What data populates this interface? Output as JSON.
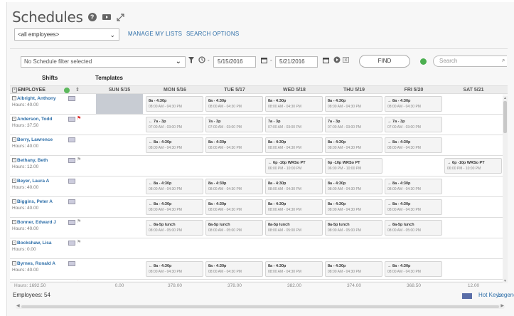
{
  "header": {
    "title": "Schedules",
    "help_icon": "?",
    "employee_select": "<all employees>",
    "links": [
      "MANAGE MY LISTS",
      "SEARCH OPTIONS"
    ]
  },
  "filter": {
    "placeholder": "No Schedule filter selected",
    "start_date": "5/15/2016",
    "end_date": "5/21/2016",
    "find_label": "FIND",
    "search_placeholder": "Search"
  },
  "tabs": [
    "Shifts",
    "Templates"
  ],
  "columns": {
    "employee": "EMPLOYEE",
    "days": [
      "SUN 5/15",
      "MON 5/16",
      "TUE 5/17",
      "WED 5/18",
      "THU 5/19",
      "FRI 5/20",
      "SAT 5/21"
    ]
  },
  "employees": [
    {
      "name": "Albright, Anthony",
      "hours": "Hours: 40.00",
      "flag": "",
      "shifts": [
        null,
        [
          "8a - 4:30p",
          "08:00 AM - 04:30 PM"
        ],
        [
          "8a - 4:30p",
          "08:00 AM - 04:30 PM"
        ],
        [
          "8a - 4:30p",
          "08:00 AM - 04:30 PM"
        ],
        [
          "8a - 4:30p",
          "08:00 AM - 04:30 PM"
        ],
        [
          "→ 8a - 4:30p",
          "08:00 AM - 04:30 PM"
        ],
        null
      ]
    },
    {
      "name": "Anderson, Todd",
      "hours": "Hours: 37.50",
      "flag": "red",
      "shifts": [
        null,
        [
          "← 7a - 3p",
          "07:00 AM - 03:00 PM"
        ],
        [
          "7a - 3p",
          "07:00 AM - 03:00 PM"
        ],
        [
          "7a - 3p",
          "07:00 AM - 03:00 PM"
        ],
        [
          "7a - 3p",
          "07:00 AM - 03:00 PM"
        ],
        [
          "→ 7a - 3p",
          "07:00 AM - 03:00 PM"
        ],
        null
      ]
    },
    {
      "name": "Berry, Lawrence",
      "hours": "Hours: 40.00",
      "flag": "",
      "shifts": [
        null,
        [
          "← 8a - 4:30p",
          "08:00 AM - 04:30 PM"
        ],
        [
          "8a - 4:30p",
          "08:00 AM - 04:30 PM"
        ],
        [
          "8a - 4:30p",
          "08:00 AM - 04:30 PM"
        ],
        [
          "8a - 4:30p",
          "08:00 AM - 04:30 PM"
        ],
        [
          "→ 8a - 4:30p",
          "08:00 AM - 04:30 PM"
        ],
        null
      ]
    },
    {
      "name": "Bethany, Beth",
      "hours": "Hours: 12.00",
      "flag": "gray",
      "shifts": [
        null,
        null,
        null,
        [
          "← 6p -10p WRSo PT",
          "06:00 PM - 10:00 PM"
        ],
        [
          "6p -10p WRSo PT",
          "06:00 PM - 10:00 PM"
        ],
        null,
        [
          "→ 6p -10p WRSo PT",
          "06:00 PM - 10:00 PM"
        ]
      ]
    },
    {
      "name": "Beyer, Laura A",
      "hours": "Hours: 40.00",
      "flag": "",
      "shifts": [
        null,
        [
          "← 8a - 4:30p",
          "08:00 AM - 04:30 PM"
        ],
        [
          "8a - 4:30p",
          "08:00 AM - 04:30 PM"
        ],
        [
          "8a - 4:30p",
          "08:00 AM - 04:30 PM"
        ],
        [
          "8a - 4:30p",
          "08:00 AM - 04:30 PM"
        ],
        [
          "→ 8a - 4:30p",
          "08:00 AM - 04:30 PM"
        ],
        null
      ]
    },
    {
      "name": "Biggins, Peter A",
      "hours": "Hours: 40.00",
      "flag": "",
      "shifts": [
        null,
        [
          "← 8a - 4:30p",
          "08:00 AM - 04:30 PM"
        ],
        [
          "8a - 4:30p",
          "08:00 AM - 04:30 PM"
        ],
        [
          "8a - 4:30p",
          "08:00 AM - 04:30 PM"
        ],
        [
          "8a - 4:30p",
          "08:00 AM - 04:30 PM"
        ],
        [
          "→ 8a - 4:30p",
          "08:00 AM - 04:30 PM"
        ],
        null
      ]
    },
    {
      "name": "Bonner, Edward J",
      "hours": "Hours: 40.00",
      "flag": "gray",
      "shifts": [
        null,
        [
          "← 8a-5p lunch",
          "08:00 AM - 05:00 PM"
        ],
        [
          "8a-5p lunch",
          "08:00 AM - 05:00 PM"
        ],
        [
          "8a-5p lunch",
          "08:00 AM - 05:00 PM"
        ],
        [
          "8a-5p lunch",
          "08:00 AM - 05:00 PM"
        ],
        [
          "→ 8a-5p lunch",
          "08:00 AM - 05:00 PM"
        ],
        null
      ]
    },
    {
      "name": "Bockshaw, Lisa",
      "hours": "Hours: 0.00",
      "flag": "gray",
      "shifts": [
        null,
        null,
        null,
        null,
        null,
        null,
        null
      ]
    },
    {
      "name": "Byrnes, Ronald A",
      "hours": "Hours: 40.00",
      "flag": "",
      "shifts": [
        null,
        [
          "← 8a - 4:30p",
          "08:00 AM - 04:30 PM"
        ],
        [
          "8a - 4:30p",
          "08:00 AM - 04:30 PM"
        ],
        [
          "8a - 4:30p",
          "08:00 AM - 04:30 PM"
        ],
        [
          "8a - 4:30p",
          "08:00 AM - 04:30 PM"
        ],
        [
          "→ 8a - 4:30p",
          "08:00 AM - 04:30 PM"
        ],
        null
      ]
    },
    {
      "name": "Byrune, Richard",
      "hours": "Hours: 40.00",
      "flag": "red",
      "shifts": [
        null,
        [
          "← 8a - 4:30p",
          "08:00 AM - 04:30 PM"
        ],
        [
          "8a - 4:30p",
          "08:00 AM - 04:30 PM"
        ],
        [
          "8a - 4:30p",
          "08:00 AM - 04:30 PM"
        ],
        [
          "8a - 4:30p",
          "08:00 AM - 04:30 PM"
        ],
        [
          "→ 8a - 4:30p",
          "08:00 AM - 04:30 PM"
        ],
        null
      ]
    }
  ],
  "totals": {
    "label": "Hours: 1692.50",
    "days": [
      "0.00",
      "378.00",
      "378.00",
      "382.00",
      "374.00",
      "368.50",
      "12.00"
    ]
  },
  "footer": {
    "employee_count": "Employees: 54",
    "hot_keys": "Hot Keys",
    "legend": "Legend"
  },
  "colors": {
    "link": "#2d6ea8",
    "sunday_block": "#c8ccd3",
    "go_button": "#4caf50"
  }
}
